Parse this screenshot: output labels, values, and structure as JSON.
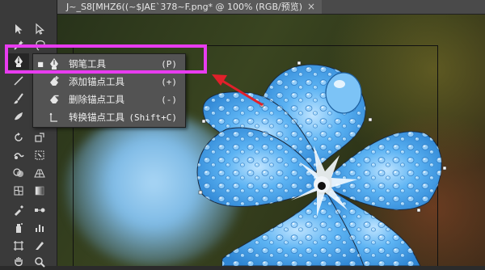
{
  "document": {
    "tab_title": "J~_S8[MHZ6((~$JAE`378~F.png* @ 100% (RGB/预览)",
    "close_glyph": "×"
  },
  "tools": [
    {
      "name": "selection-tool-icon"
    },
    {
      "name": "direct-selection-tool-icon"
    },
    {
      "name": "magic-wand-tool-icon"
    },
    {
      "name": "lasso-tool-icon"
    },
    {
      "name": "pen-tool-icon",
      "active": true
    },
    {
      "name": "type-tool-icon"
    },
    {
      "name": "line-tool-icon"
    },
    {
      "name": "rectangle-tool-icon"
    },
    {
      "name": "paintbrush-tool-icon"
    },
    {
      "name": "pencil-tool-icon"
    },
    {
      "name": "blob-brush-tool-icon"
    },
    {
      "name": "eraser-tool-icon"
    },
    {
      "name": "rotate-tool-icon"
    },
    {
      "name": "scale-tool-icon"
    },
    {
      "name": "warp-tool-icon"
    },
    {
      "name": "free-transform-tool-icon"
    },
    {
      "name": "shape-builder-tool-icon"
    },
    {
      "name": "perspective-grid-tool-icon"
    },
    {
      "name": "mesh-tool-icon"
    },
    {
      "name": "gradient-tool-icon"
    },
    {
      "name": "eyedropper-tool-icon"
    },
    {
      "name": "blend-tool-icon"
    },
    {
      "name": "symbol-sprayer-tool-icon"
    },
    {
      "name": "column-graph-tool-icon"
    },
    {
      "name": "artboard-tool-icon"
    },
    {
      "name": "slice-tool-icon"
    },
    {
      "name": "hand-tool-icon"
    },
    {
      "name": "zoom-tool-icon"
    }
  ],
  "flyout": {
    "items": [
      {
        "label": "钢笔工具",
        "shortcut": "(P)",
        "selected": true,
        "icon": "pen-icon"
      },
      {
        "label": "添加锚点工具",
        "shortcut": "(+)",
        "selected": false,
        "icon": "add-anchor-point-icon"
      },
      {
        "label": "删除锚点工具",
        "shortcut": "(-)",
        "selected": false,
        "icon": "delete-anchor-point-icon"
      },
      {
        "label": "转换锚点工具",
        "shortcut": "(Shift+C)",
        "selected": false,
        "icon": "convert-anchor-point-icon"
      }
    ],
    "selected_bullet": "■"
  },
  "colors": {
    "highlight": "#e83cf0",
    "arrow": "#e0202a",
    "flower": "#4aa6ee"
  }
}
